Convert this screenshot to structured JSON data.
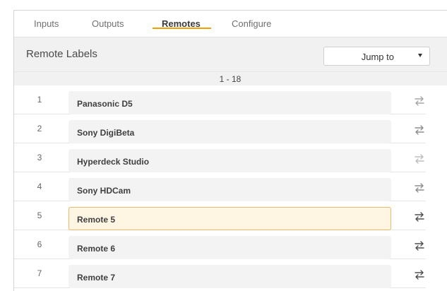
{
  "tabs": [
    {
      "label": "Inputs",
      "active": false
    },
    {
      "label": "Outputs",
      "active": false
    },
    {
      "label": "Remotes",
      "active": true
    },
    {
      "label": "Configure",
      "active": false
    }
  ],
  "header": {
    "title": "Remote Labels",
    "jump_label": "Jump to"
  },
  "range": "1 - 18",
  "rows": [
    {
      "num": "1",
      "label": "Panasonic D5",
      "icon": "swap-arrows-icon"
    },
    {
      "num": "2",
      "label": "Sony DigiBeta",
      "icon": "swap-arrows-icon"
    },
    {
      "num": "3",
      "label": "Hyperdeck Studio",
      "icon": "swap-arrows-icon"
    },
    {
      "num": "4",
      "label": "Sony HDCam",
      "icon": "swap-arrows-icon"
    },
    {
      "num": "5",
      "label": "Remote 5",
      "icon": "swap-arrows-icon",
      "active": true
    },
    {
      "num": "6",
      "label": "Remote 6",
      "icon": "swap-arrows-icon"
    },
    {
      "num": "7",
      "label": "Remote 7",
      "icon": "swap-arrows-icon"
    }
  ],
  "colors": {
    "accent": "#f0a000",
    "active_field_bg": "#fff5e3",
    "active_field_border": "#e9b86c",
    "header_bg": "#f1f1f1"
  }
}
